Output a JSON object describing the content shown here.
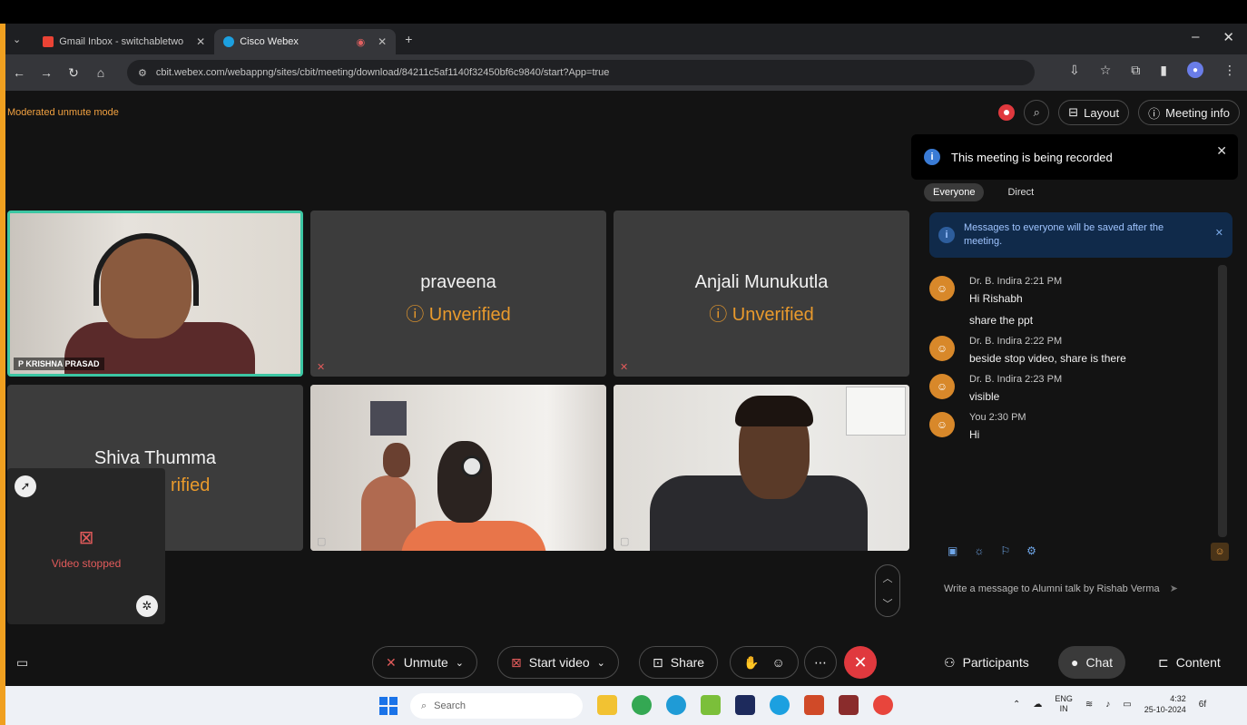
{
  "browser": {
    "tabs": [
      {
        "label": "Gmail Inbox - switchabletwo",
        "icon": "gmail-icon",
        "active": false
      },
      {
        "label": "Cisco Webex",
        "icon": "webex-icon",
        "active": true
      }
    ],
    "new_tab": "+",
    "url": "cbit.webex.com/webappng/sites/cbit/meeting/download/84211c5af1140f32450bf6c9840/start?App=true"
  },
  "meeting": {
    "mode_text": "Moderated unmute mode",
    "header": {
      "layout_label": "Layout",
      "meeting_info_label": "Meeting info"
    },
    "tiles": [
      {
        "name": "P KRISHNA PRASAD",
        "type": "video"
      },
      {
        "name": "praveena",
        "status": "Unverified"
      },
      {
        "name": "Anjali Munukutla",
        "status": "Unverified"
      },
      {
        "name": "Shiva Thumma",
        "status": "Unverified",
        "status_visible": "rified"
      },
      {
        "name": "",
        "type": "video"
      },
      {
        "name": "",
        "type": "video"
      }
    ],
    "self_view": {
      "status": "Video stopped"
    }
  },
  "panel": {
    "toast": "This meeting is being recorded",
    "chat_tabs": [
      "Everyone",
      "Direct"
    ],
    "notice": "Messages to everyone will be saved after the meeting.",
    "messages": [
      {
        "sender": "Dr. B. Indira",
        "time": "2:21 PM",
        "lines": [
          "Hi Rishabh",
          "share the ppt"
        ]
      },
      {
        "sender": "Dr. B. Indira",
        "time": "2:22 PM",
        "lines": [
          "beside stop video, share is there"
        ]
      },
      {
        "sender": "Dr. B. Indira",
        "time": "2:23 PM",
        "lines": [
          "visible"
        ]
      },
      {
        "sender": "You",
        "time": "2:30 PM",
        "lines": [
          "Hi"
        ]
      }
    ],
    "composer_placeholder": "Write a message to Alumni talk by Rishab Verma"
  },
  "controls": {
    "unmute": "Unmute",
    "start_video": "Start video",
    "share": "Share",
    "participants": "Participants",
    "chat": "Chat",
    "content": "Content"
  },
  "taskbar": {
    "search_placeholder": "Search",
    "lang": "ENG",
    "lang_sub": "IN",
    "time": "4:32",
    "date": "25-10-2024",
    "temp": "6f"
  },
  "colors": {
    "accent_orange": "#f0a020",
    "unverified": "#e99a2c",
    "end_red": "#e0393e",
    "active_speaker": "#3cc6a3"
  }
}
